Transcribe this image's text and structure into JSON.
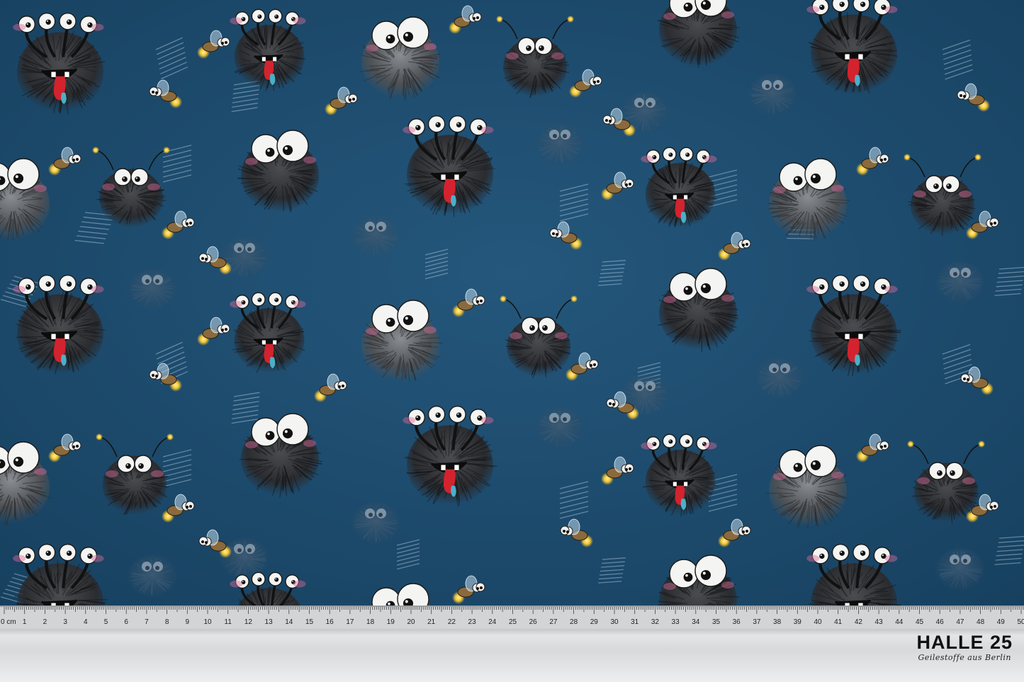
{
  "image": {
    "subject": "fabric-swatch-with-ruler",
    "background_color": "#1d4a6d"
  },
  "ruler": {
    "unit_label": "0 cm",
    "numbers": [
      "1",
      "2",
      "3",
      "4",
      "5",
      "6",
      "7",
      "8",
      "9",
      "10",
      "11",
      "12",
      "13",
      "14",
      "15",
      "16",
      "17",
      "18",
      "19",
      "20",
      "21",
      "22",
      "23",
      "24",
      "25",
      "26",
      "27",
      "28",
      "29",
      "30",
      "31",
      "32",
      "33",
      "34",
      "35",
      "36",
      "37",
      "38",
      "39",
      "40",
      "41",
      "42",
      "43",
      "44",
      "45",
      "46",
      "47",
      "48",
      "49",
      "50"
    ]
  },
  "logo": {
    "title": "HALLE 25",
    "subtitle": "Geilestoffe aus Berlin"
  }
}
